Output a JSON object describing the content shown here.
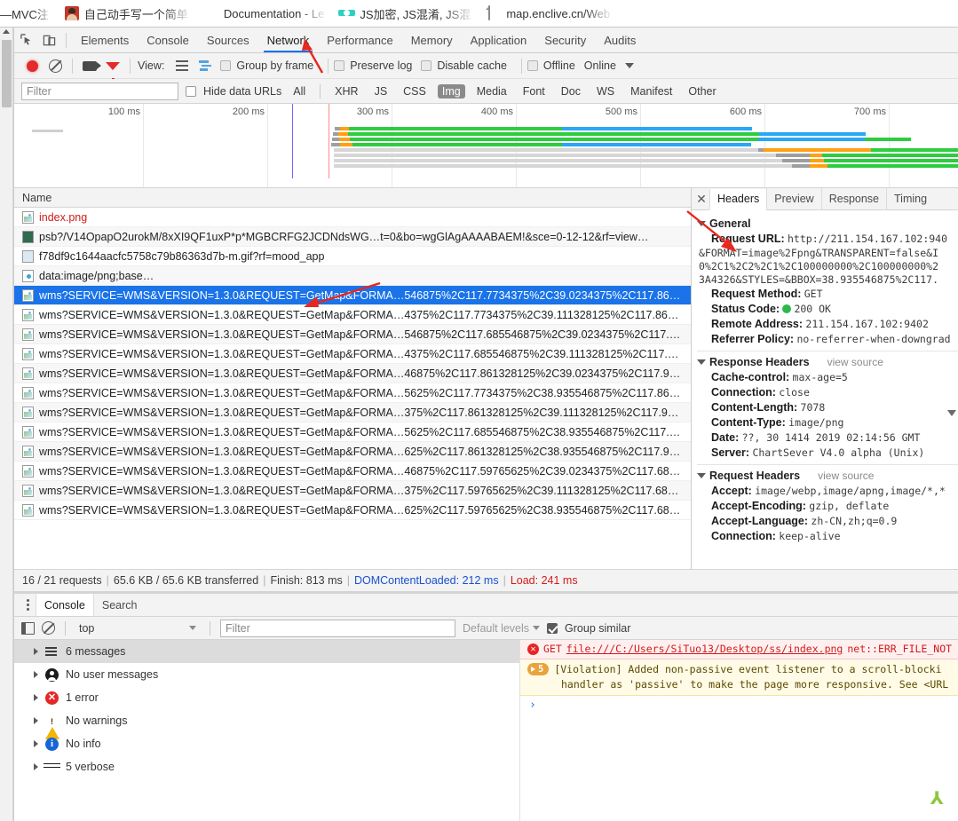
{
  "browser_tabs": [
    {
      "title": "—MVC注",
      "icon": "none-icon"
    },
    {
      "title": "自己动手写一个简单",
      "icon": "avatar-favicon"
    },
    {
      "title": "Documentation - Le",
      "icon": "leaf-favicon"
    },
    {
      "title": "JS加密, JS混淆, JS混",
      "icon": "gear-favicon"
    },
    {
      "title": "map.enclive.cn/Web",
      "icon": "document-favicon"
    }
  ],
  "devtools": {
    "tabs": [
      {
        "label": "Elements",
        "selected": false
      },
      {
        "label": "Console",
        "selected": false
      },
      {
        "label": "Sources",
        "selected": false
      },
      {
        "label": "Network",
        "selected": true
      },
      {
        "label": "Performance",
        "selected": false
      },
      {
        "label": "Memory",
        "selected": false
      },
      {
        "label": "Application",
        "selected": false
      },
      {
        "label": "Security",
        "selected": false
      },
      {
        "label": "Audits",
        "selected": false
      }
    ],
    "network_controls": {
      "record_label": "record-button",
      "clear_label": "clear-button",
      "screenshot_label": "capture-screenshots-button",
      "filter_toggle_label": "filter-toggle-button",
      "view_label": "View:",
      "group_by_frame": "Group by frame",
      "preserve_log": "Preserve log",
      "disable_cache": "Disable cache",
      "offline": "Offline",
      "online": "Online"
    },
    "filter_bar": {
      "placeholder": "Filter",
      "value": "",
      "hide_data_urls": "Hide data URLs",
      "types": [
        "All",
        "XHR",
        "JS",
        "CSS",
        "Img",
        "Media",
        "Font",
        "Doc",
        "WS",
        "Manifest",
        "Other"
      ],
      "active_type": "Img"
    },
    "overview": {
      "ticks": [
        "100 ms",
        "200 ms",
        "300 ms",
        "400 ms",
        "500 ms",
        "600 ms",
        "700 ms"
      ]
    },
    "list": {
      "column_header": "Name",
      "rows": [
        {
          "name": "index.png",
          "icon": "image-file-icon",
          "error": true,
          "selected": false
        },
        {
          "name": "psb?/V14OpapO2urokM/8xXI9QF1uxP*p*MGBCRFG2JCDNdsWG…t=0&bo=wgGlAgAAAABAEM!&sce=0-12-12&rf=view…",
          "icon": "dark-image-file-icon",
          "error": false,
          "selected": false
        },
        {
          "name": "f78df9c1644aacfc5758c79b86363d7b-m.gif?rf=mood_app",
          "icon": "gif-file-icon",
          "error": false,
          "selected": false
        },
        {
          "name": "data:image/png;base…",
          "icon": "data-url-icon",
          "error": false,
          "selected": false
        },
        {
          "name": "wms?SERVICE=WMS&VERSION=1.3.0&REQUEST=GetMap&FORMA…546875%2C117.7734375%2C39.0234375%2C117.86…",
          "icon": "image-file-icon",
          "error": false,
          "selected": true
        },
        {
          "name": "wms?SERVICE=WMS&VERSION=1.3.0&REQUEST=GetMap&FORMA…4375%2C117.7734375%2C39.111328125%2C117.86…",
          "icon": "image-file-icon",
          "error": false,
          "selected": false
        },
        {
          "name": "wms?SERVICE=WMS&VERSION=1.3.0&REQUEST=GetMap&FORMA…546875%2C117.685546875%2C39.0234375%2C117.…",
          "icon": "image-file-icon",
          "error": false,
          "selected": false
        },
        {
          "name": "wms?SERVICE=WMS&VERSION=1.3.0&REQUEST=GetMap&FORMA…4375%2C117.685546875%2C39.111328125%2C117.…",
          "icon": "image-file-icon",
          "error": false,
          "selected": false
        },
        {
          "name": "wms?SERVICE=WMS&VERSION=1.3.0&REQUEST=GetMap&FORMA…46875%2C117.861328125%2C39.0234375%2C117.9…",
          "icon": "image-file-icon",
          "error": false,
          "selected": false
        },
        {
          "name": "wms?SERVICE=WMS&VERSION=1.3.0&REQUEST=GetMap&FORMA…5625%2C117.7734375%2C38.935546875%2C117.86…",
          "icon": "image-file-icon",
          "error": false,
          "selected": false
        },
        {
          "name": "wms?SERVICE=WMS&VERSION=1.3.0&REQUEST=GetMap&FORMA…375%2C117.861328125%2C39.111328125%2C117.9…",
          "icon": "image-file-icon",
          "error": false,
          "selected": false
        },
        {
          "name": "wms?SERVICE=WMS&VERSION=1.3.0&REQUEST=GetMap&FORMA…5625%2C117.685546875%2C38.935546875%2C117.…",
          "icon": "image-file-icon",
          "error": false,
          "selected": false
        },
        {
          "name": "wms?SERVICE=WMS&VERSION=1.3.0&REQUEST=GetMap&FORMA…625%2C117.861328125%2C38.935546875%2C117.9…",
          "icon": "image-file-icon",
          "error": false,
          "selected": false
        },
        {
          "name": "wms?SERVICE=WMS&VERSION=1.3.0&REQUEST=GetMap&FORMA…46875%2C117.59765625%2C39.0234375%2C117.68…",
          "icon": "image-file-icon",
          "error": false,
          "selected": false
        },
        {
          "name": "wms?SERVICE=WMS&VERSION=1.3.0&REQUEST=GetMap&FORMA…375%2C117.59765625%2C39.111328125%2C117.68…",
          "icon": "image-file-icon",
          "error": false,
          "selected": false
        },
        {
          "name": "wms?SERVICE=WMS&VERSION=1.3.0&REQUEST=GetMap&FORMA…625%2C117.59765625%2C38.935546875%2C117.68…",
          "icon": "image-file-icon",
          "error": false,
          "selected": false
        }
      ]
    },
    "details": {
      "tabs": [
        {
          "label": "Headers",
          "selected": true
        },
        {
          "label": "Preview",
          "selected": false
        },
        {
          "label": "Response",
          "selected": false
        },
        {
          "label": "Timing",
          "selected": false
        }
      ],
      "general": {
        "title": "General",
        "request_url_key": "Request URL:",
        "request_url_lines": [
          "http://211.154.167.102:940",
          "&FORMAT=image%2Fpng&TRANSPARENT=false&I",
          "0%2C1%2C2%2C1%2C100000000%2C100000000%2",
          "3A4326&STYLES=&BBOX=38.935546875%2C117."
        ],
        "request_method_key": "Request Method:",
        "request_method": "GET",
        "status_code_key": "Status Code:",
        "status_code": "200 OK",
        "remote_address_key": "Remote Address:",
        "remote_address": "211.154.167.102:9402",
        "referrer_policy_key": "Referrer Policy:",
        "referrer_policy": "no-referrer-when-downgrad"
      },
      "response_headers": {
        "title": "Response Headers",
        "view_source": "view source",
        "items": [
          {
            "key": "Cache-control:",
            "value": "max-age=5"
          },
          {
            "key": "Connection:",
            "value": "close"
          },
          {
            "key": "Content-Length:",
            "value": "7078"
          },
          {
            "key": "Content-Type:",
            "value": "image/png"
          },
          {
            "key": "Date:",
            "value": "??, 30 1414 2019 02:14:56 GMT"
          },
          {
            "key": "Server:",
            "value": "ChartSever V4.0 alpha (Unix)"
          }
        ]
      },
      "request_headers": {
        "title": "Request Headers",
        "view_source": "view source",
        "items": [
          {
            "key": "Accept:",
            "value": "image/webp,image/apng,image/*,*"
          },
          {
            "key": "Accept-Encoding:",
            "value": "gzip, deflate"
          },
          {
            "key": "Accept-Language:",
            "value": "zh-CN,zh;q=0.9"
          },
          {
            "key": "Connection:",
            "value": "keep-alive"
          }
        ]
      }
    },
    "status_bar": {
      "requests": "16 / 21 requests",
      "transferred": "65.6 KB / 65.6 KB transferred",
      "finish": "Finish: 813 ms",
      "dom_content_loaded": "DOMContentLoaded: 212 ms",
      "load": "Load: 241 ms"
    }
  },
  "drawer": {
    "tabs": [
      {
        "label": "Console",
        "selected": true
      },
      {
        "label": "Search",
        "selected": false
      }
    ],
    "controls": {
      "context": "top",
      "filter_placeholder": "Filter",
      "filter_value": "",
      "levels": "Default levels",
      "group_similar": "Group similar",
      "group_similar_checked": true
    },
    "sidebar": [
      {
        "label": "6 messages",
        "icon": "list-icon",
        "selected": true
      },
      {
        "label": "No user messages",
        "icon": "user-icon",
        "selected": false
      },
      {
        "label": "1 error",
        "icon": "error-icon",
        "selected": false
      },
      {
        "label": "No warnings",
        "icon": "warning-icon",
        "selected": false
      },
      {
        "label": "No info",
        "icon": "info-icon",
        "selected": false
      },
      {
        "label": "5 verbose",
        "icon": "bug-icon",
        "selected": false
      }
    ],
    "messages": [
      {
        "type": "error",
        "method": "GET",
        "url": "file:///C:/Users/SiTuo13/Desktop/ss/index.png",
        "detail": "net::ERR_FILE_NOT"
      },
      {
        "type": "violation",
        "count": "5",
        "line1": "[Violation] Added non-passive event listener to a scroll-blocki",
        "line2": "handler as 'passive' to make the page more responsive. See <URL"
      }
    ],
    "prompt": "›"
  },
  "colors": {
    "accent": "#1a73e8",
    "error": "#d11b1b",
    "success": "#2bb94a",
    "warning": "#f5b400",
    "waterfall_green": "#2ecc40",
    "waterfall_blue": "#29a7f5",
    "waterfall_orange": "#ffa114",
    "waterfall_gray": "#d0d0d0"
  },
  "bottom_glyph": "⅄"
}
